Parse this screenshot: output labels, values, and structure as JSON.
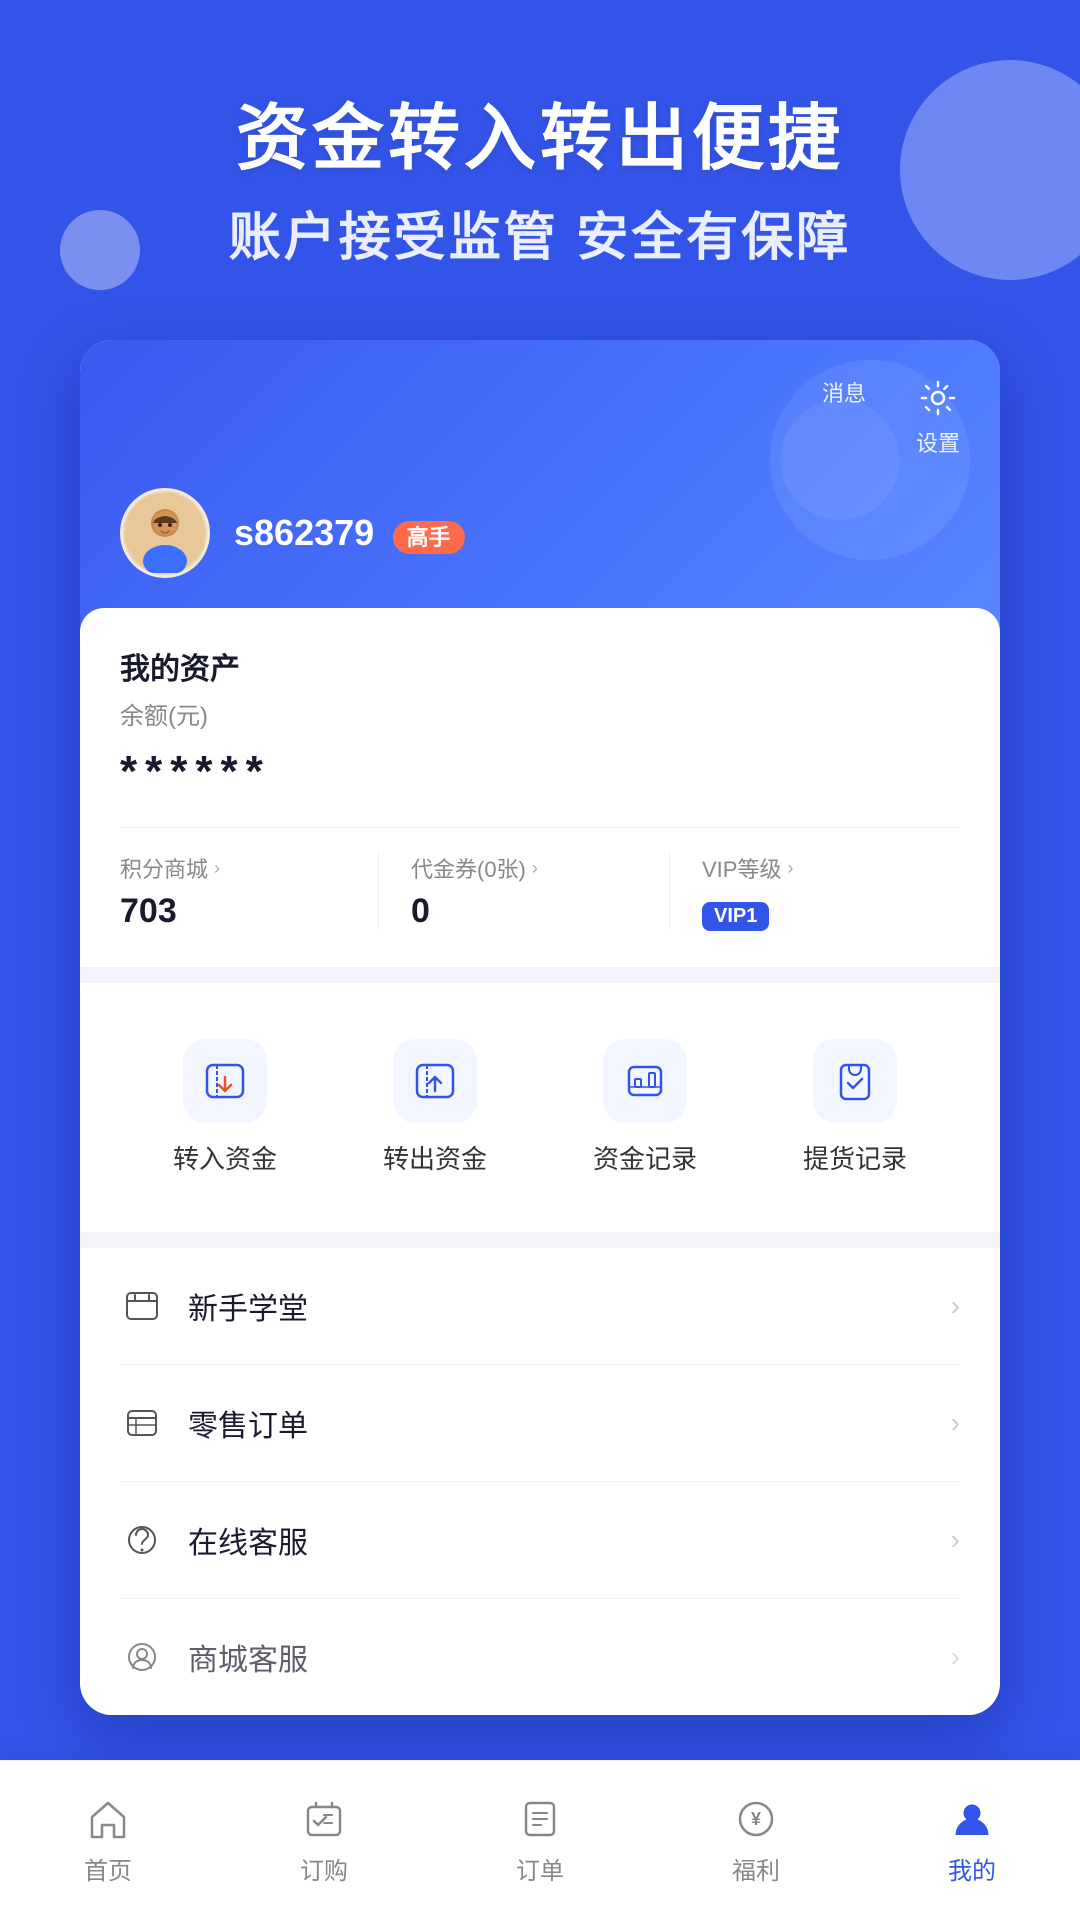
{
  "hero": {
    "title": "资金转入转出便捷",
    "subtitle": "账户接受监管 安全有保障"
  },
  "profile": {
    "username": "s862379",
    "badge": "高手"
  },
  "assets": {
    "title": "我的资产",
    "balance_label": "余额(元)",
    "balance_masked": "******",
    "stats": [
      {
        "label": "积分商城",
        "value": "703"
      },
      {
        "label": "代金券(0张)",
        "value": "0"
      },
      {
        "label": "VIP等级",
        "value": "VIP1",
        "is_vip": true
      }
    ]
  },
  "actions": [
    {
      "id": "transfer-in",
      "label": "转入资金"
    },
    {
      "id": "transfer-out",
      "label": "转出资金"
    },
    {
      "id": "fund-record",
      "label": "资金记录"
    },
    {
      "id": "pickup-record",
      "label": "提货记录"
    }
  ],
  "menu": [
    {
      "id": "beginner",
      "label": "新手学堂"
    },
    {
      "id": "retail-order",
      "label": "零售订单"
    },
    {
      "id": "online-support",
      "label": "在线客服"
    },
    {
      "id": "nearby",
      "label": "商城客服"
    }
  ],
  "top_icons": [
    {
      "id": "message",
      "label": "消息"
    },
    {
      "id": "settings",
      "label": "设置"
    }
  ],
  "bottom_nav": [
    {
      "id": "home",
      "label": "首页",
      "active": false
    },
    {
      "id": "order-buy",
      "label": "订购",
      "active": false
    },
    {
      "id": "order",
      "label": "订单",
      "active": false
    },
    {
      "id": "welfare",
      "label": "福利",
      "active": false
    },
    {
      "id": "mine",
      "label": "我的",
      "active": true
    }
  ]
}
